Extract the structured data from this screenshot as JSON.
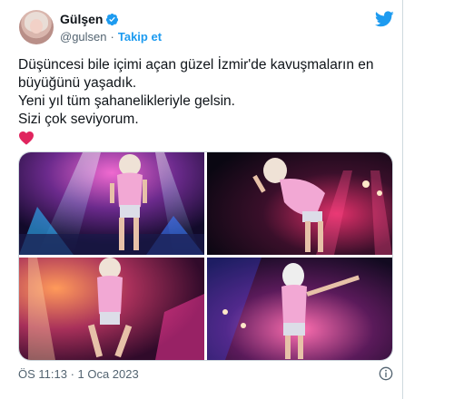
{
  "tweet": {
    "author_name": "Gülşen",
    "handle": "@gulsen",
    "separator": "·",
    "follow_label": "Takip et",
    "text_lines": [
      "Düşüncesi bile içimi açan güzel İzmir'de kavuşmaların en",
      "büyüğünü yaşadık.",
      "Yeni yıl tüm şahanelikleriyle gelsin.",
      "Sizi çok seviyorum."
    ],
    "timestamp": "ÖS 11:13 · 1 Oca 2023"
  },
  "icons": {
    "verified": "verified-badge-icon",
    "twitter": "twitter-bird-icon",
    "heart": "red-heart-emoji",
    "info": "info-icon"
  },
  "colors": {
    "accent": "#1d9bf0",
    "text": "#0f1419",
    "secondary": "#536471",
    "heart": "#e0245e",
    "border": "#cfd9de"
  }
}
